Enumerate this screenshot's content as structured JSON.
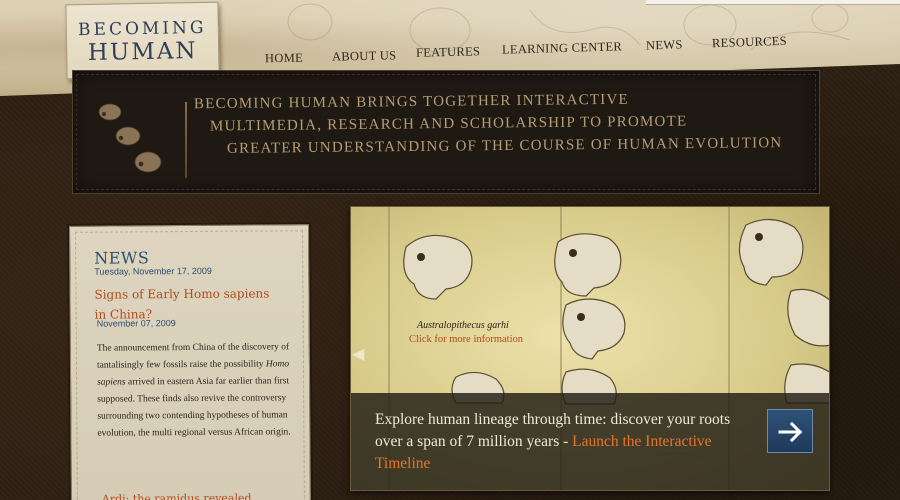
{
  "logo": {
    "line1": "BECOMING",
    "line2": "HUMAN"
  },
  "nav": [
    {
      "label": "HOME"
    },
    {
      "label": "ABOUT US"
    },
    {
      "label": "FEATURES"
    },
    {
      "label": "LEARNING CENTER"
    },
    {
      "label": "NEWS"
    },
    {
      "label": "RESOURCES"
    }
  ],
  "tagline": [
    "BECOMING HUMAN BRINGS TOGETHER INTERACTIVE",
    "MULTIMEDIA, RESEARCH AND SCHOLARSHIP TO PROMOTE",
    "GREATER UNDERSTANDING OF THE COURSE OF HUMAN EVOLUTION"
  ],
  "news": {
    "heading": "NEWS",
    "date": "Tuesday, November 17, 2009",
    "headline": "Signs of Early Homo sapiens in China?",
    "headline_date": "November 07, 2009",
    "body_part1": "The announcement from China of the discovery of tantalisingly few fossils raise the possibility ",
    "body_italic": "Homo sapiens",
    "body_part2": " arrived in eastern Asia far earlier than first supposed.  These finds also revive the controversy surrounding two contending hypotheses of human evolution, the multi regional versus  African origin.",
    "next_headline": "Ardi: the ramidus revealed"
  },
  "feature": {
    "species": "Australopithecus garhi",
    "click_label": "Click for more information",
    "caption": "Explore human lineage through time: discover your roots over a span of 7 million years  - ",
    "caption_link": "Launch the Interactive Timeline",
    "colors": {
      "link": "#e2762e",
      "button": "#1e3a5a"
    }
  }
}
